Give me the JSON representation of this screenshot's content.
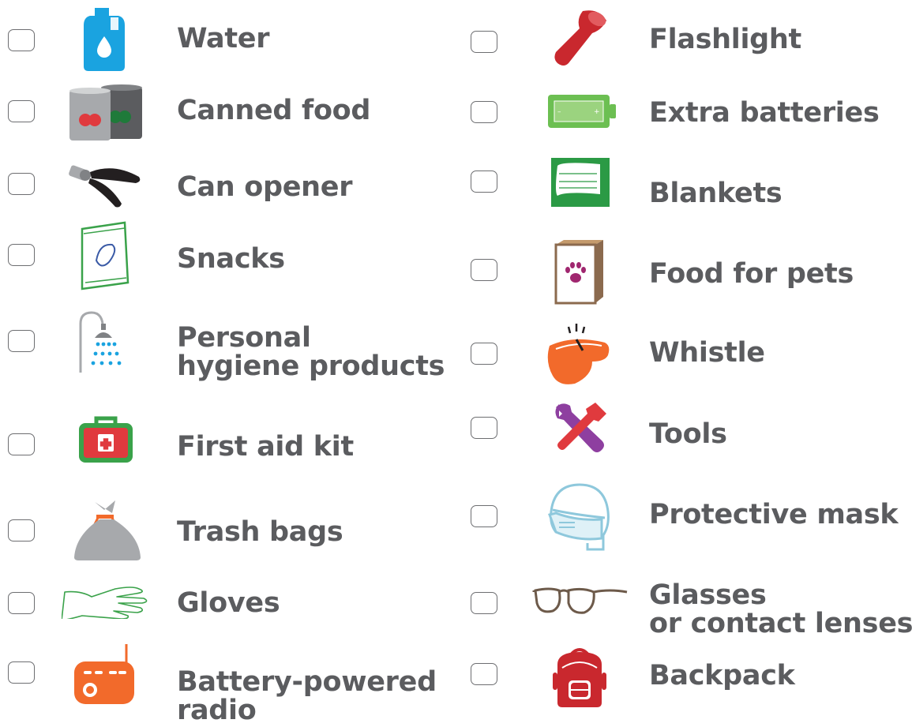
{
  "checklist": {
    "left": [
      {
        "label": "Water",
        "icon": "water-jug-icon"
      },
      {
        "label": "Canned food",
        "icon": "canned-food-icon"
      },
      {
        "label": "Can opener",
        "icon": "can-opener-icon"
      },
      {
        "label": "Snacks",
        "icon": "snacks-icon"
      },
      {
        "label_lines": [
          "Personal",
          "hygiene products"
        ],
        "icon": "shower-icon"
      },
      {
        "label": "First aid kit",
        "icon": "first-aid-kit-icon"
      },
      {
        "label": "Trash bags",
        "icon": "trash-bag-icon"
      },
      {
        "label": "Gloves",
        "icon": "glove-icon"
      },
      {
        "label_lines": [
          "Battery-powered",
          "radio"
        ],
        "icon": "radio-icon"
      }
    ],
    "right": [
      {
        "label": "Flashlight",
        "icon": "flashlight-icon"
      },
      {
        "label": "Extra batteries",
        "icon": "battery-icon"
      },
      {
        "label": "Blankets",
        "icon": "blanket-icon"
      },
      {
        "label": "Food for pets",
        "icon": "pet-food-icon"
      },
      {
        "label": "Whistle",
        "icon": "whistle-icon"
      },
      {
        "label": "Tools",
        "icon": "tools-icon"
      },
      {
        "label": "Protective mask",
        "icon": "mask-icon"
      },
      {
        "label_lines": [
          "Glasses",
          "or contact lenses"
        ],
        "icon": "glasses-icon"
      },
      {
        "label": "Backpack",
        "icon": "backpack-icon"
      }
    ]
  },
  "colors": {
    "text": "#5b5c5f",
    "checkbox_border": "#6d6e71",
    "water": "#1aa3e0",
    "red": "#e03a3e",
    "green": "#3aa24a",
    "orange": "#f26a2b",
    "purple": "#8e3fa0",
    "mask": "#8ec8dc",
    "grey": "#a7a9ac",
    "brown": "#8b6a4e"
  }
}
